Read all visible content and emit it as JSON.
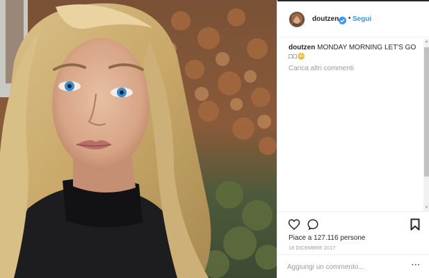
{
  "post": {
    "photo_icon": "selfie-photo",
    "author": {
      "username": "doutzen",
      "verified_icon": "verified-badge-icon",
      "separator": "•",
      "follow_label": "Segui"
    },
    "caption": {
      "username": "doutzen",
      "text": "MONDAY MORNING LET'S GO",
      "emoji_line": "□□😳"
    },
    "load_more_label": "Carica altri commenti",
    "actions": {
      "like_icon": "heart-icon",
      "comment_icon": "comment-icon",
      "save_icon": "bookmark-icon"
    },
    "likes_text": "Piace a 127.116 persone",
    "date_text": "18 DICEMBRE 2017",
    "comment_input": {
      "placeholder": "Aggiungi un commento...",
      "value": ""
    },
    "more_options_label": "···"
  },
  "colors": {
    "link_blue": "#3897f0",
    "text_dark": "#262626",
    "text_muted": "#999999",
    "border": "#efefef"
  }
}
